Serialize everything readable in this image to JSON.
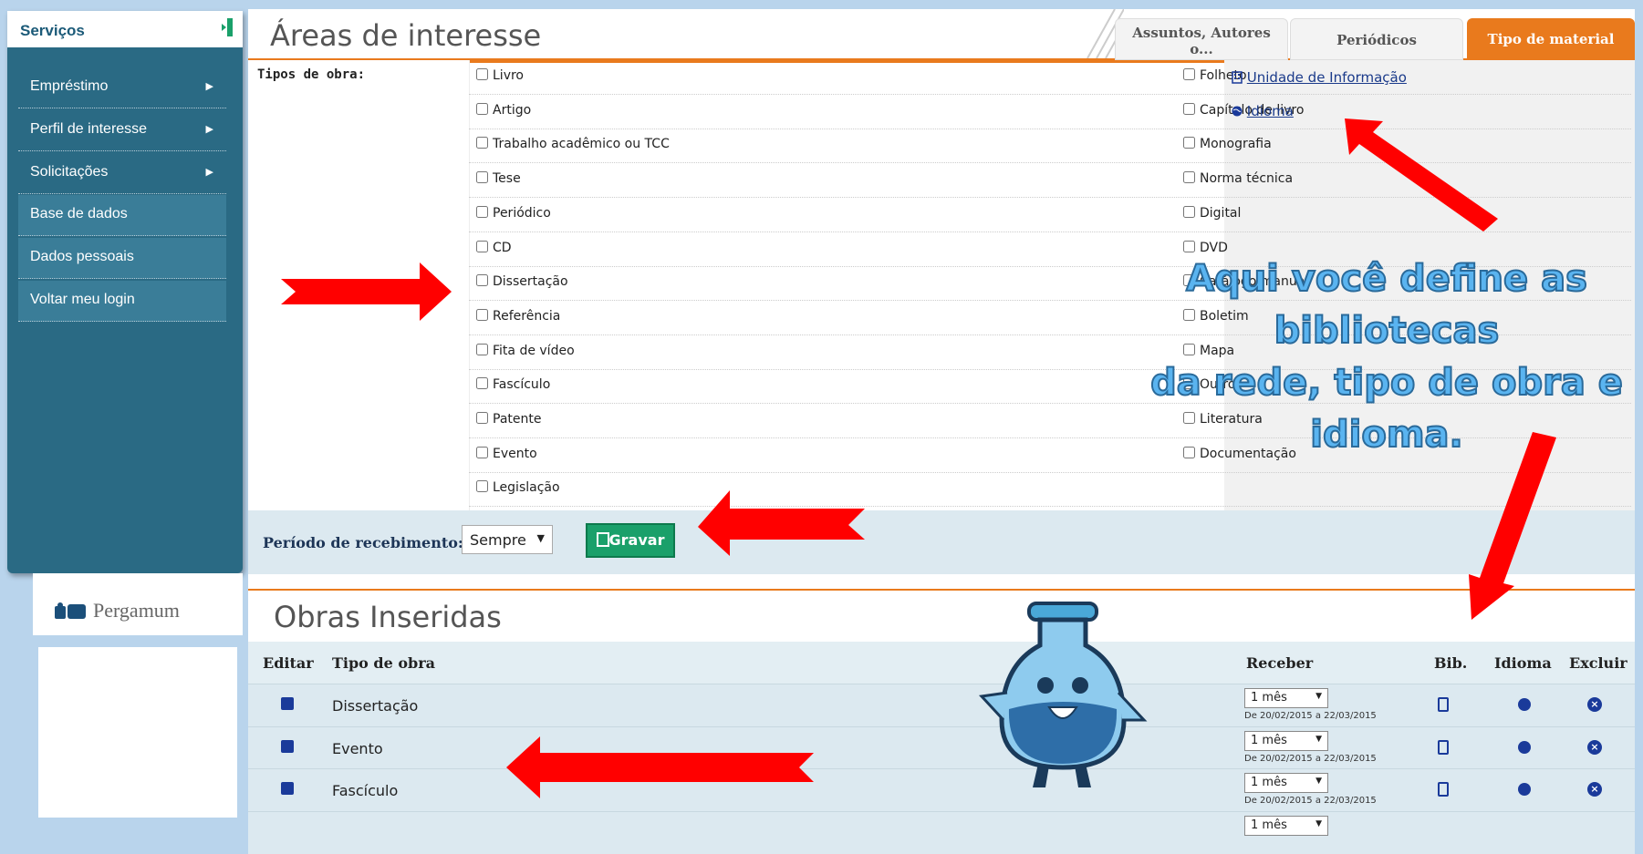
{
  "sidebar": {
    "title": "Serviços",
    "items": [
      {
        "label": "Empréstimo",
        "arrow": "▶"
      },
      {
        "label": "Perfil de interesse",
        "arrow": "▶"
      },
      {
        "label": "Solicitações",
        "arrow": "▶"
      },
      {
        "label": "Base de dados"
      },
      {
        "label": "Dados pessoais"
      },
      {
        "label": "Voltar meu login"
      }
    ],
    "logo_text": "Pergamum"
  },
  "header": {
    "title": "Áreas de interesse",
    "tabs": [
      {
        "line1": "Assuntos, Autores",
        "line2": "o..."
      },
      {
        "line1": "Periódicos"
      },
      {
        "line1": "Tipo de material",
        "active": true
      }
    ]
  },
  "types": {
    "label": "Tipos de obra:",
    "col1": [
      "Livro",
      "Artigo",
      "Trabalho acadêmico ou TCC",
      "Tese",
      "Periódico",
      "CD",
      "Dissertação",
      "Referência",
      "Fita de vídeo",
      "Fascículo",
      "Patente",
      "Evento",
      "Legislação"
    ],
    "col2": [
      "Folheto",
      "Capítulo de livro",
      "Monografia",
      "Norma técnica",
      "Digital",
      "DVD",
      "Catálogo manual",
      "Boletim",
      "Mapa",
      "Outro",
      "Literatura",
      "Documentação"
    ],
    "links": {
      "unidade": "Unidade de Informação",
      "idioma": "Idioma"
    }
  },
  "periodo": {
    "label": "Período de recebimento:",
    "value": "Sempre",
    "button": "Gravar"
  },
  "obras": {
    "title": "Obras Inseridas",
    "headers": {
      "editar": "Editar",
      "tipo": "Tipo de obra",
      "receber": "Receber",
      "bib": "Bib.",
      "idioma": "Idioma",
      "excluir": "Excluir"
    },
    "rows": [
      {
        "tipo": "Dissertação",
        "receber": "1 mês",
        "periodo": "De 20/02/2015 a 22/03/2015"
      },
      {
        "tipo": "Evento",
        "receber": "1 mês",
        "periodo": "De 20/02/2015 a 22/03/2015"
      },
      {
        "tipo": "Fascículo",
        "receber": "1 mês",
        "periodo": "De 20/02/2015 a 22/03/2015"
      },
      {
        "tipo": "",
        "receber": "1 mês",
        "periodo": ""
      }
    ]
  },
  "annotation": {
    "line1": "Aqui você define as",
    "line2": "bibliotecas",
    "line3": "da rede, tipo de obra  e",
    "line4": "idioma."
  },
  "colors": {
    "accent": "#e97a1d",
    "sidebar": "#2a6a84",
    "arrows": "#ff0000",
    "note": "#5ab4f0"
  }
}
